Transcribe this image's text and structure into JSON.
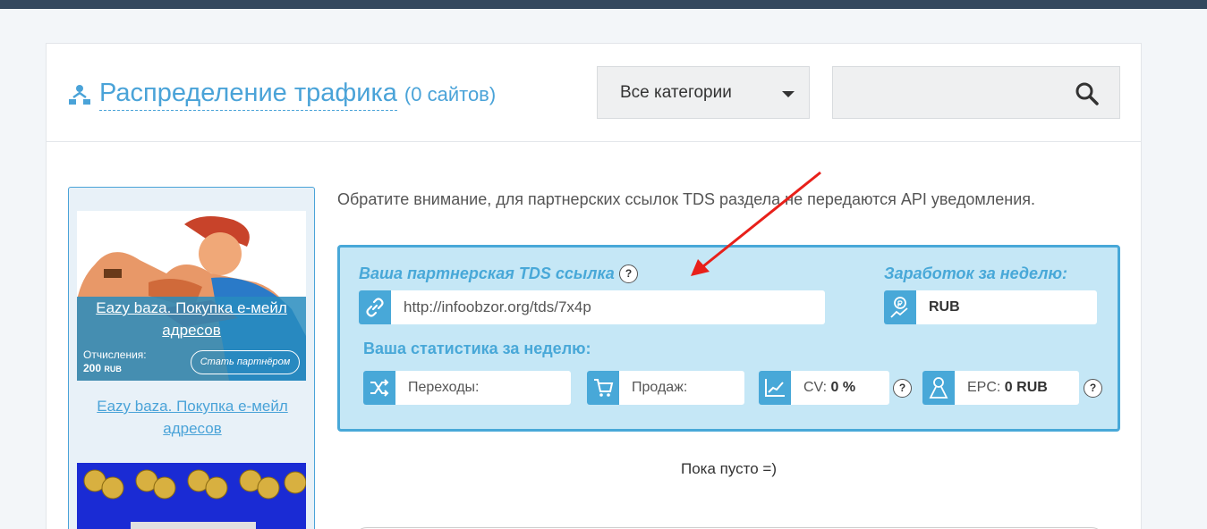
{
  "header": {
    "title": "Распределение трафика",
    "count": "(0 сайтов)",
    "category_select": "Все категории",
    "search_placeholder": ""
  },
  "sidebar": {
    "offer_title": "Eazy baza. Покупка е-мейл адресов",
    "payout_label": "Отчисления:",
    "payout_value": "200",
    "payout_currency": "RUB",
    "partner_button": "Стать партнёром",
    "offer_link": "Eazy baza. Покупка е-мейл адресов"
  },
  "main": {
    "notice": "Обратите внимание, для партнерских ссылок TDS раздела не передаются API уведомления.",
    "tds_label": "Ваша партнерская TDS ссылка",
    "tds_link": "http://infoobzor.org/tds/7x4p",
    "earnings_label": "Заработок за неделю:",
    "earnings_value": "RUB",
    "stats_label": "Ваша статистика за неделю:",
    "stats": {
      "clicks_label": "Переходы:",
      "sales_label": "Продаж:",
      "cv_label": "CV:",
      "cv_value": "0 %",
      "epc_label": "EPC:",
      "epc_value": "0 RUB"
    },
    "help_glyph": "?",
    "empty_text": "Пока пусто =)"
  },
  "colors": {
    "accent": "#48a8d8",
    "topbar": "#34495e",
    "arrow": "#e8201a"
  }
}
